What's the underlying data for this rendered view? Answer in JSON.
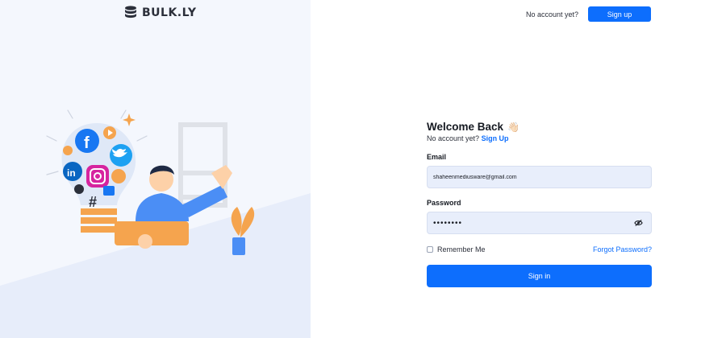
{
  "brand": {
    "name": "BULK.LY"
  },
  "header": {
    "prompt": "No account yet?",
    "signup_label": "Sign up"
  },
  "form": {
    "title": "Welcome Back",
    "wave_emoji": "👋🏻",
    "sub_prompt": "No account yet?",
    "sub_link": "Sign Up",
    "email_label": "Email",
    "email_value": "shaheenmediusware@gmail.com",
    "password_label": "Password",
    "password_value": "••••••••",
    "remember_label": "Remember Me",
    "forgot_label": "Forgot Password?",
    "signin_label": "Sign in"
  },
  "colors": {
    "primary": "#0d6efd",
    "panel": "#f4f7fd",
    "input_bg": "#e8eefb"
  },
  "icons": {
    "logo": "database-icon",
    "password_toggle": "eye-slash-icon"
  }
}
